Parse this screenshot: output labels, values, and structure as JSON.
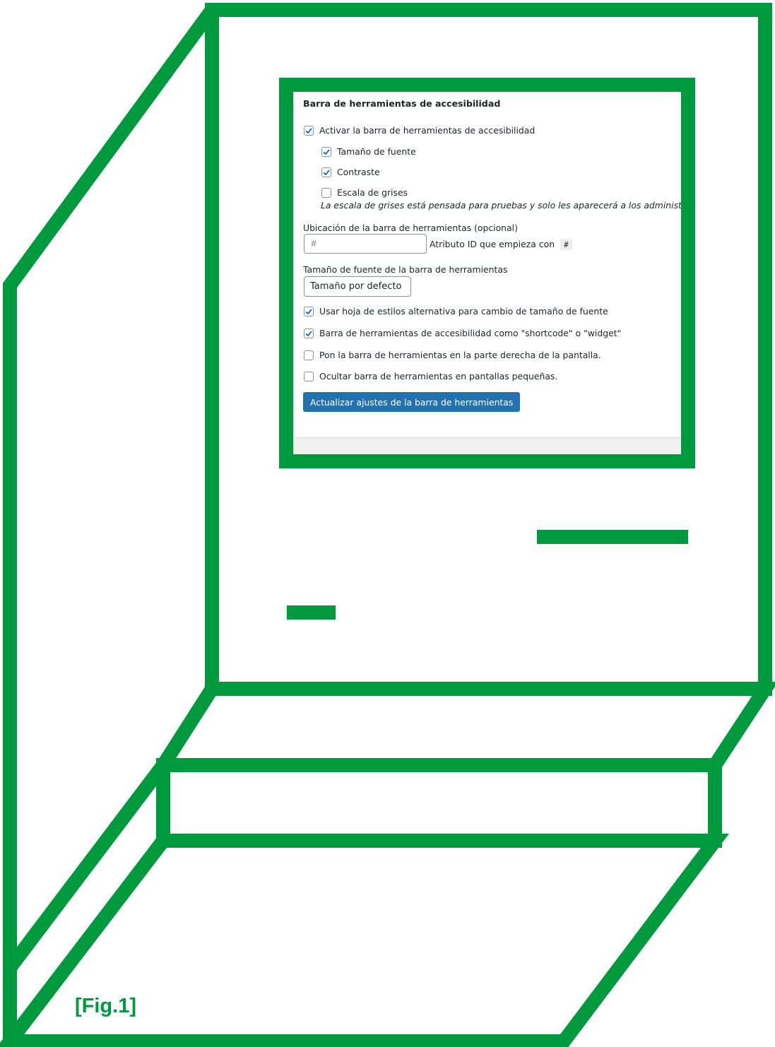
{
  "figure_label": "[Fig.1]",
  "colors": {
    "frame_green": "#009a3e",
    "button_blue": "#2271b1"
  },
  "panel": {
    "title": "Barra de herramientas de accesibilidad",
    "enable": {
      "label": "Activar la barra de herramientas de accesibilidad",
      "checked": true
    },
    "font_size": {
      "label": "Tamaño de fuente",
      "checked": true
    },
    "contrast": {
      "label": "Contraste",
      "checked": true
    },
    "grayscale": {
      "label": "Escala de grises",
      "checked": false
    },
    "grayscale_hint": "La escala de grises está pensada para pruebas y solo les aparecerá a los administradores conec",
    "location_label": "Ubicación de la barra de herramientas (opcional)",
    "location_placeholder": "#",
    "location_desc": "Atributo ID que empieza con",
    "location_code": "#",
    "font_size_label": "Tamaño de fuente de la barra de herramientas",
    "font_size_select": "Tamaño por defecto",
    "alt_stylesheet": {
      "label": "Usar hoja de estilos alternativa para cambio de tamaño de fuente",
      "checked": true
    },
    "shortcode": {
      "label": "Barra de herramientas de accesibilidad como \"shortcode\" o \"widget\"",
      "checked": true
    },
    "right_side": {
      "label": "Pon la barra de herramientas en la parte derecha de la pantalla.",
      "checked": false
    },
    "hide_small": {
      "label": "Ocultar barra de herramientas en pantallas pequeñas.",
      "checked": false
    },
    "submit_label": "Actualizar ajustes de la barra de herramientas"
  }
}
